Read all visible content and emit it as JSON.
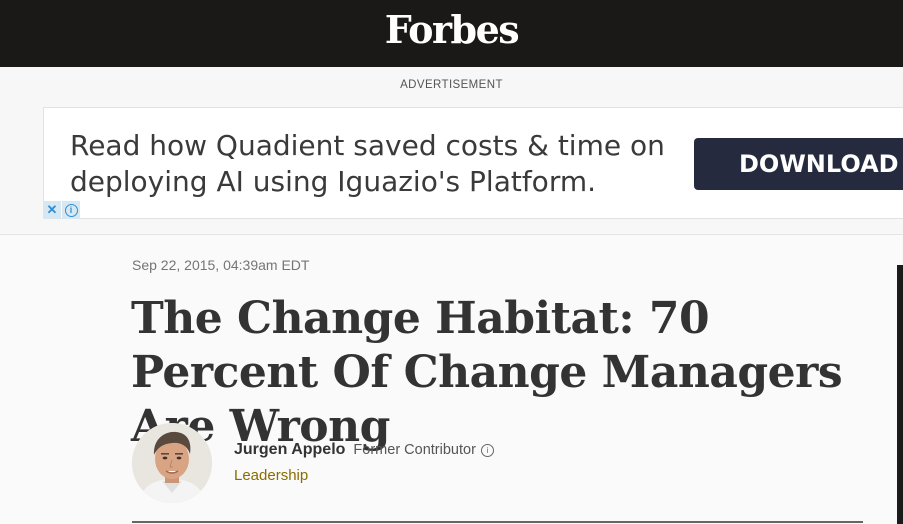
{
  "header": {
    "logo_text": "Forbes"
  },
  "ad": {
    "label": "ADVERTISEMENT",
    "text": "Read how Quadient saved costs & time on deploying AI using Iguazio's Platform.",
    "button_label": "DOWNLOAD",
    "close_icon": "close-icon",
    "info_icon": "info-icon"
  },
  "article": {
    "date": "Sep 22, 2015, 04:39am EDT",
    "headline": "The Change Habitat: 70 Percent Of Change Managers Are Wrong",
    "author": {
      "name": "Jurgen Appelo",
      "role": "Former Contributor",
      "section": "Leadership"
    }
  },
  "colors": {
    "header_bg": "#1b1918",
    "ad_button_bg": "#252a3f",
    "section_link": "#8a6d00",
    "headline": "#333333"
  }
}
